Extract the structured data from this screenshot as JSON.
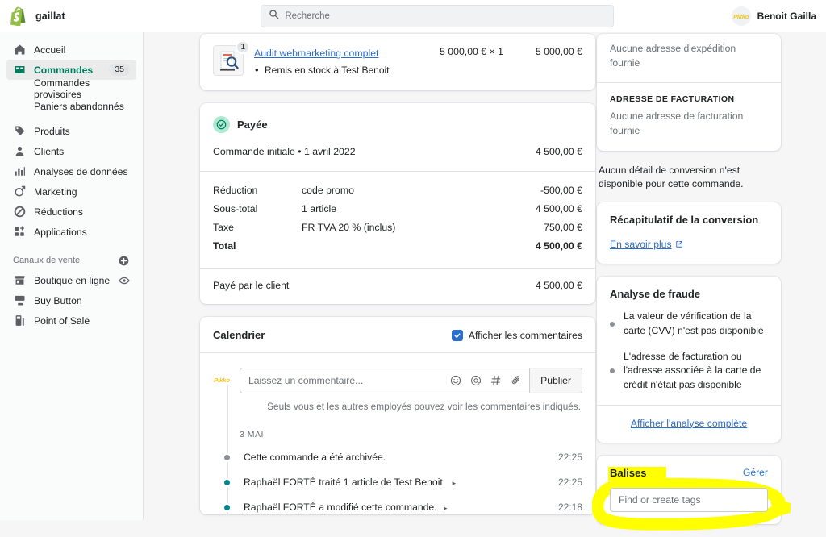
{
  "topbar": {
    "brand_name": "gaillat",
    "search_placeholder": "Recherche",
    "avatar_text": "Pikko",
    "user_name": "Benoit Gailla"
  },
  "sidebar": {
    "items": [
      {
        "label": "Accueil",
        "icon": "home-icon",
        "badge": ""
      },
      {
        "label": "Commandes",
        "icon": "orders-icon",
        "badge": "35"
      },
      {
        "label": "Produits",
        "icon": "products-icon",
        "badge": ""
      },
      {
        "label": "Clients",
        "icon": "customers-icon",
        "badge": ""
      },
      {
        "label": "Analyses de données",
        "icon": "analytics-icon",
        "badge": ""
      },
      {
        "label": "Marketing",
        "icon": "marketing-icon",
        "badge": ""
      },
      {
        "label": "Réductions",
        "icon": "discounts-icon",
        "badge": ""
      },
      {
        "label": "Applications",
        "icon": "apps-icon",
        "badge": ""
      }
    ],
    "sub_items": [
      {
        "label": "Commandes provisoires"
      },
      {
        "label": "Paniers abandonnés"
      }
    ],
    "channels_title": "Canaux de vente",
    "channels": [
      {
        "label": "Boutique en ligne",
        "icon": "storefront-icon",
        "trailing": "eye-icon"
      },
      {
        "label": "Buy Button",
        "icon": "buy-button-icon",
        "trailing": ""
      },
      {
        "label": "Point of Sale",
        "icon": "pos-icon",
        "trailing": ""
      }
    ]
  },
  "order": {
    "product": {
      "quantity_badge": "1",
      "title": "Audit webmarketing complet",
      "note": "Remis en stock à Test Benoit",
      "unit_price": "5 000,00 € × 1",
      "line_total": "5 000,00 €"
    },
    "payment": {
      "status": "Payée",
      "initial_label": "Commande initiale • 1 avril 2022",
      "initial_amount": "4 500,00 €",
      "lines": [
        {
          "label": "Réduction",
          "detail": "code promo",
          "amount": "-500,00 €",
          "bold": false
        },
        {
          "label": "Sous-total",
          "detail": "1 article",
          "amount": "4 500,00 €",
          "bold": false
        },
        {
          "label": "Taxe",
          "detail": "FR TVA 20 % (inclus)",
          "amount": "750,00 €",
          "bold": false
        },
        {
          "label": "Total",
          "detail": "",
          "amount": "4 500,00 €",
          "bold": true
        }
      ],
      "paid_label": "Payé par le client",
      "paid_amount": "4 500,00 €"
    },
    "timeline": {
      "title": "Calendrier",
      "show_comments_label": "Afficher les commentaires",
      "show_comments_checked": true,
      "comment_placeholder": "Laissez un commentaire...",
      "publish_label": "Publier",
      "hint": "Seuls vous et les autres employés pouvez voir les commentaires indiqués.",
      "avatar_text": "Pikko",
      "date_group": "3 MAI",
      "events": [
        {
          "text": "Cette commande a été archivée.",
          "time": "22:25",
          "dot": "#8c9196",
          "expandable": false
        },
        {
          "text": "Raphaël FORTÉ traité 1 article de Test Benoit.",
          "time": "22:25",
          "dot": "#00848e",
          "expandable": true
        },
        {
          "text": "Raphaël FORTÉ a modifié cette commande.",
          "time": "22:18",
          "dot": "#00848e",
          "expandable": true
        }
      ]
    }
  },
  "right_panel": {
    "shipping_address_text": "Aucune adresse d'expédition fournie",
    "billing_caption": "ADRESSE DE FACTURATION",
    "billing_address_text": "Aucune adresse de facturation fournie",
    "conversion_note": "Aucun détail de conversion n'est disponible pour cette commande.",
    "conversion_title": "Récapitulatif de la conversion",
    "conversion_link": "En savoir plus",
    "fraud_title": "Analyse de fraude",
    "fraud_items": [
      "La valeur de vérification de la carte (CVV) n'est pas disponible",
      "L'adresse de facturation ou l'adresse associée à la carte de crédit n'était pas disponible"
    ],
    "fraud_link": "Afficher l'analyse complète",
    "tags_title": "Balises",
    "tags_manage_label": "Gérer",
    "tags_placeholder": "Find or create tags"
  },
  "colors": {
    "accent_green": "#007b5c",
    "link_blue": "#2c6ecb",
    "teal_dot": "#00848e",
    "grey_dot": "#8c9196",
    "highlight_yellow": "#ffff00",
    "checkbox_blue": "#2c6ecb"
  }
}
